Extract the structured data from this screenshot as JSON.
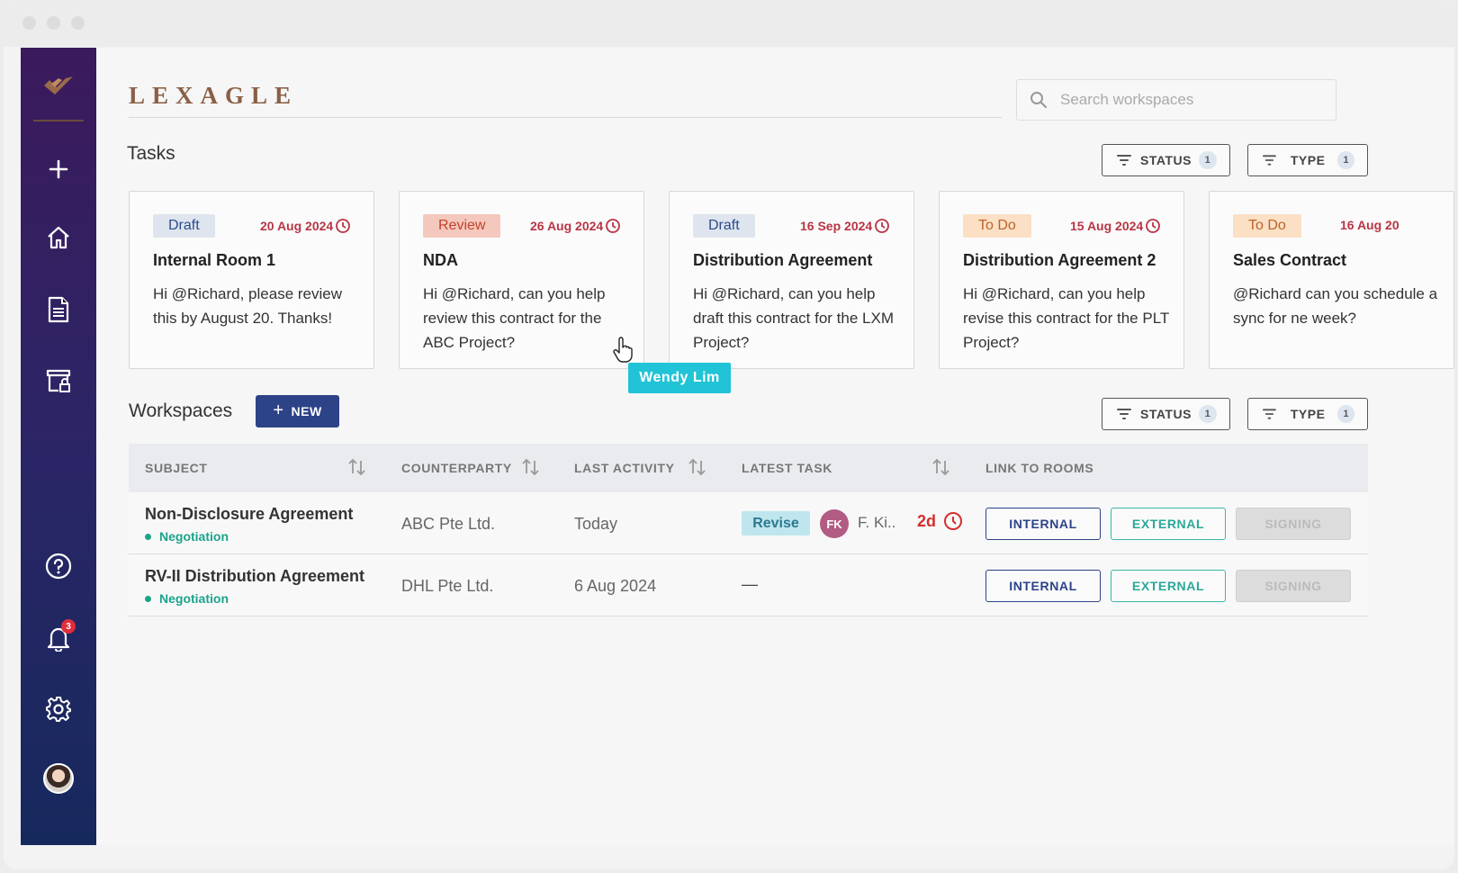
{
  "brand": "LEXAGLE",
  "search": {
    "placeholder": "Search workspaces"
  },
  "sidebar": {
    "items": [
      {
        "name": "new-icon"
      },
      {
        "name": "home-icon"
      },
      {
        "name": "document-icon"
      },
      {
        "name": "archive-lock-icon"
      },
      {
        "name": "help-icon"
      },
      {
        "name": "bell-icon",
        "badge": "3"
      },
      {
        "name": "gear-icon"
      },
      {
        "name": "profile-avatar"
      }
    ]
  },
  "tasks": {
    "title": "Tasks",
    "filters": {
      "status_label": "STATUS",
      "status_count": "1",
      "type_label": "TYPE",
      "type_count": "1"
    },
    "cards": [
      {
        "tag": "Draft",
        "due": "20 Aug 2024",
        "title": "Internal Room 1",
        "body": "Hi @Richard, please review this by August 20. Thanks!"
      },
      {
        "tag": "Review",
        "due": "26 Aug 2024",
        "title": "NDA",
        "body": "Hi @Richard, can you help review this contract for the ABC Project?"
      },
      {
        "tag": "Draft",
        "due": "16 Sep 2024",
        "title": "Distribution Agreement",
        "body": "Hi @Richard, can you help draft this contract for the LXM Project?"
      },
      {
        "tag": "To Do",
        "due": "15 Aug 2024",
        "title": "Distribution Agreement 2",
        "body": "Hi @Richard, can you help revise this contract for the PLT Project?"
      },
      {
        "tag": "To Do",
        "due": "16 Aug 20",
        "title": "Sales Contract",
        "body": "@Richard can you schedule a sync for ne week?"
      }
    ],
    "tooltip": "Wendy Lim"
  },
  "workspaces": {
    "title": "Workspaces",
    "new_label": "NEW",
    "filters": {
      "status_label": "STATUS",
      "status_count": "1",
      "type_label": "TYPE",
      "type_count": "1"
    },
    "columns": {
      "subject": "SUBJECT",
      "counterparty": "COUNTERPARTY",
      "last_activity": "LAST ACTIVITY",
      "latest_task": "LATEST TASK",
      "link_to_rooms": "LINK TO ROOMS"
    },
    "rows": [
      {
        "subject": "Non-Disclosure Agreement",
        "stage": "Negotiation",
        "counterparty": "ABC Pte Ltd.",
        "last_activity": "Today",
        "task_tag": "Revise",
        "assignee_initials": "FK",
        "assignee": "F. Ki..",
        "overdue": "2d",
        "internal": "INTERNAL",
        "external": "EXTERNAL",
        "signing": "SIGNING"
      },
      {
        "subject": "RV-II Distribution Agreement",
        "stage": "Negotiation",
        "counterparty": "DHL Pte Ltd.",
        "last_activity": "6 Aug 2024",
        "task_empty": "—",
        "internal": "INTERNAL",
        "external": "EXTERNAL",
        "signing": "SIGNING"
      }
    ]
  },
  "colors": {
    "sidebar_top": "#3b1a5c",
    "sidebar_bottom": "#16295d",
    "brand": "#8a5f46",
    "primary": "#2c4387",
    "teal": "#21c4d7",
    "due_red": "#b83545"
  }
}
